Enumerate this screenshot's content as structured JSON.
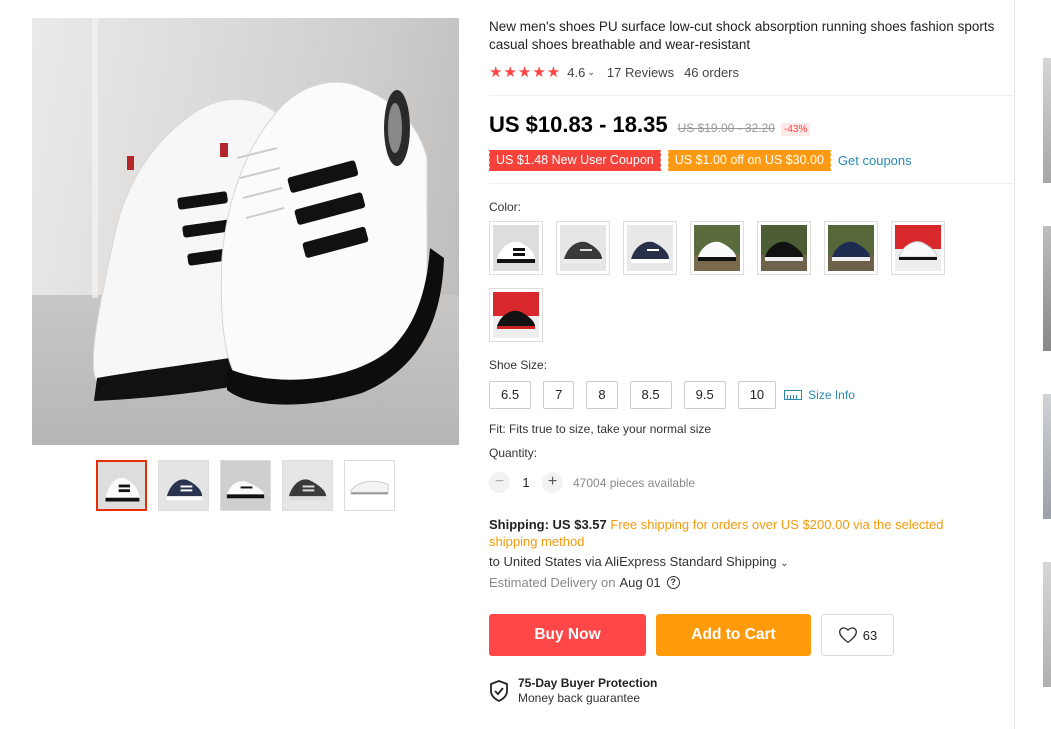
{
  "product": {
    "title": "New men's shoes PU surface low-cut shock absorption running shoes fashion sports casual shoes breathable and wear-resistant",
    "stars": "★★★★★",
    "rating": "4.6",
    "reviews": "17 Reviews",
    "orders": "46 orders",
    "price": "US $10.83 - 18.35",
    "original_price": "US $19.00 - 32.20",
    "discount": "-43%"
  },
  "coupons": {
    "new_user": "US $1.48 New User Coupon",
    "off": "US $1.00 off on US $30.00",
    "get": "Get coupons"
  },
  "color": {
    "label": "Color:",
    "options": [
      "white-black stripe",
      "gray-black",
      "navy-white",
      "white outdoor",
      "black-white outdoor",
      "navy outdoor",
      "white on red",
      "black on red"
    ]
  },
  "size": {
    "label": "Shoe Size:",
    "options": [
      "6.5",
      "7",
      "8",
      "8.5",
      "9.5",
      "10"
    ],
    "info": "Size Info"
  },
  "fit": "Fit: Fits true to size, take your normal size",
  "quantity": {
    "label": "Quantity:",
    "minus": "−",
    "value": "1",
    "plus": "+",
    "available": "47004 pieces available"
  },
  "shipping": {
    "label": "Shipping: US $3.57",
    "free": "Free shipping for orders over US $200.00 via the selected shipping method",
    "to": "to United States via AliExpress Standard Shipping",
    "est_label": "Estimated Delivery on",
    "est_date": "Aug 01"
  },
  "actions": {
    "buy": "Buy Now",
    "cart": "Add to Cart",
    "wish_count": "63"
  },
  "protection": {
    "title": "75-Day Buyer Protection",
    "subtitle": "Money back guarantee"
  },
  "colors": {
    "accent_red": "#ff4747",
    "accent_orange": "#ff9a0b",
    "link": "#2a8ab2",
    "star": "#ff4747"
  }
}
